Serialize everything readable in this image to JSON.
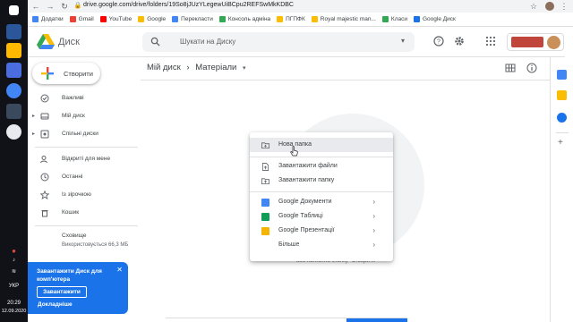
{
  "browser": {
    "url": "drive.google.com/drive/folders/19So8jJUzYLegewUiBCpu2REFSwMkKDBC",
    "bookmarks": [
      {
        "label": "Додатки",
        "color": "#4285f4"
      },
      {
        "label": "Gmail",
        "color": "#ea4335"
      },
      {
        "label": "YouTube",
        "color": "#ff0000"
      },
      {
        "label": "Google",
        "color": "#fbbc04"
      },
      {
        "label": "Перекласти",
        "color": "#4285f4"
      },
      {
        "label": "Консоль адміна",
        "color": "#34a853"
      },
      {
        "label": "ПГПФК",
        "color": "#fbbc04"
      },
      {
        "label": "Royal majestic man...",
        "color": "#fbbc04"
      },
      {
        "label": "Класи",
        "color": "#34a853"
      },
      {
        "label": "Google Диск",
        "color": "#1a73e8"
      }
    ]
  },
  "header": {
    "app_name": "Диск",
    "search_placeholder": "Шукати на Диску",
    "icons": [
      "help-icon",
      "settings-icon",
      "apps-icon"
    ]
  },
  "sidebar": {
    "new_label": "Створити",
    "items": [
      {
        "label": "Важливі",
        "icon": "priority-icon"
      },
      {
        "label": "Мій диск",
        "icon": "my-drive-icon"
      },
      {
        "label": "Спільні диски",
        "icon": "shared-drives-icon"
      },
      {
        "label": "Відкриті для мене",
        "icon": "shared-with-me-icon"
      },
      {
        "label": "Останні",
        "icon": "recent-icon"
      },
      {
        "label": "Із зірочкою",
        "icon": "starred-icon"
      },
      {
        "label": "Кошик",
        "icon": "trash-icon"
      },
      {
        "label": "Сховище",
        "icon": "storage-icon"
      }
    ],
    "storage_used": "Використовується 66,3 МБ"
  },
  "popup": {
    "title": "Завантажити Диск для комп'ютера",
    "button": "Завантажити",
    "link": "Докладніше"
  },
  "main": {
    "breadcrumb_root": "Мій диск",
    "breadcrumb_sep": "›",
    "breadcrumb_current": "Матеріали",
    "empty_hint": "або натисніть кнопку \"Створити\""
  },
  "context_menu": {
    "items": [
      {
        "label": "Нова папка",
        "icon": "new-folder-icon",
        "highlighted": true
      },
      {
        "label": "Завантажити файли",
        "icon": "file-upload-icon"
      },
      {
        "label": "Завантажити папку",
        "icon": "folder-upload-icon"
      },
      {
        "label": "Google Документи",
        "icon": "docs-icon",
        "color": "#4285f4"
      },
      {
        "label": "Google Таблиці",
        "icon": "sheets-icon",
        "color": "#0f9d58"
      },
      {
        "label": "Google Презентації",
        "icon": "slides-icon",
        "color": "#f4b400"
      },
      {
        "label": "Більше",
        "icon": ""
      }
    ],
    "arrow": "›"
  },
  "taskbar": {
    "lang": "УКР",
    "time": "20:29",
    "date": "12.09.2020"
  }
}
